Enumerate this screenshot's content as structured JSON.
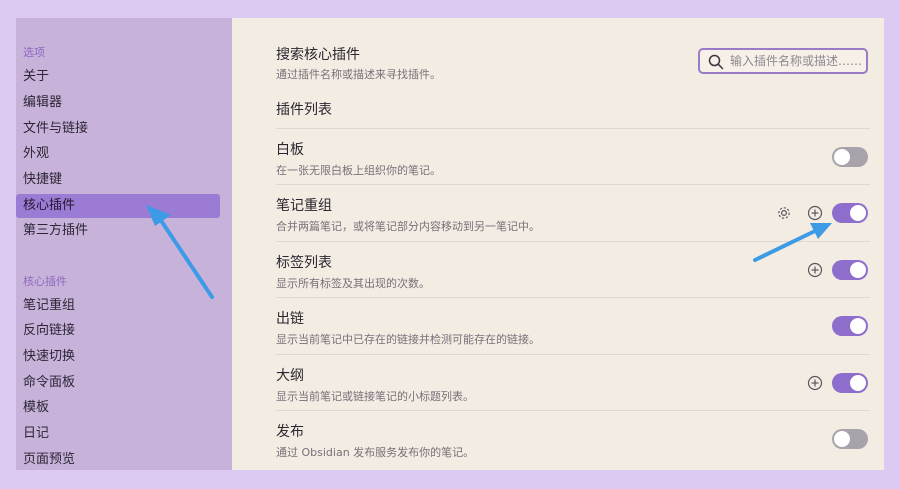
{
  "sidebar": {
    "options_heading": "选项",
    "options_items": [
      "关于",
      "编辑器",
      "文件与链接",
      "外观",
      "快捷键",
      "核心插件",
      "第三方插件"
    ],
    "plugins_heading": "核心插件",
    "plugin_items": [
      "笔记重组",
      "反向链接",
      "快速切换",
      "命令面板",
      "模板",
      "日记",
      "页面预览"
    ]
  },
  "search": {
    "title": "搜索核心插件",
    "desc": "通过插件名称或描述来寻找插件。",
    "placeholder": "输入插件名称或描述……"
  },
  "list_label": "插件列表",
  "plugins": [
    {
      "title": "白板",
      "desc": "在一张无限白板上组织你的笔记。",
      "enabled": false
    },
    {
      "title": "笔记重组",
      "desc": "合并两篇笔记，或将笔记部分内容移动到另一笔记中。",
      "enabled": true
    },
    {
      "title": "标签列表",
      "desc": "显示所有标签及其出现的次数。",
      "enabled": true
    },
    {
      "title": "出链",
      "desc": "显示当前笔记中已存在的链接并检测可能存在的链接。",
      "enabled": true
    },
    {
      "title": "大纲",
      "desc": "显示当前笔记或链接笔记的小标题列表。",
      "enabled": true
    },
    {
      "title": "发布",
      "desc": "通过 Obsidian 发布服务发布你的笔记。",
      "enabled": false
    }
  ],
  "colors": {
    "accent": "#8e6dcc",
    "arrow": "#3d9be6"
  }
}
